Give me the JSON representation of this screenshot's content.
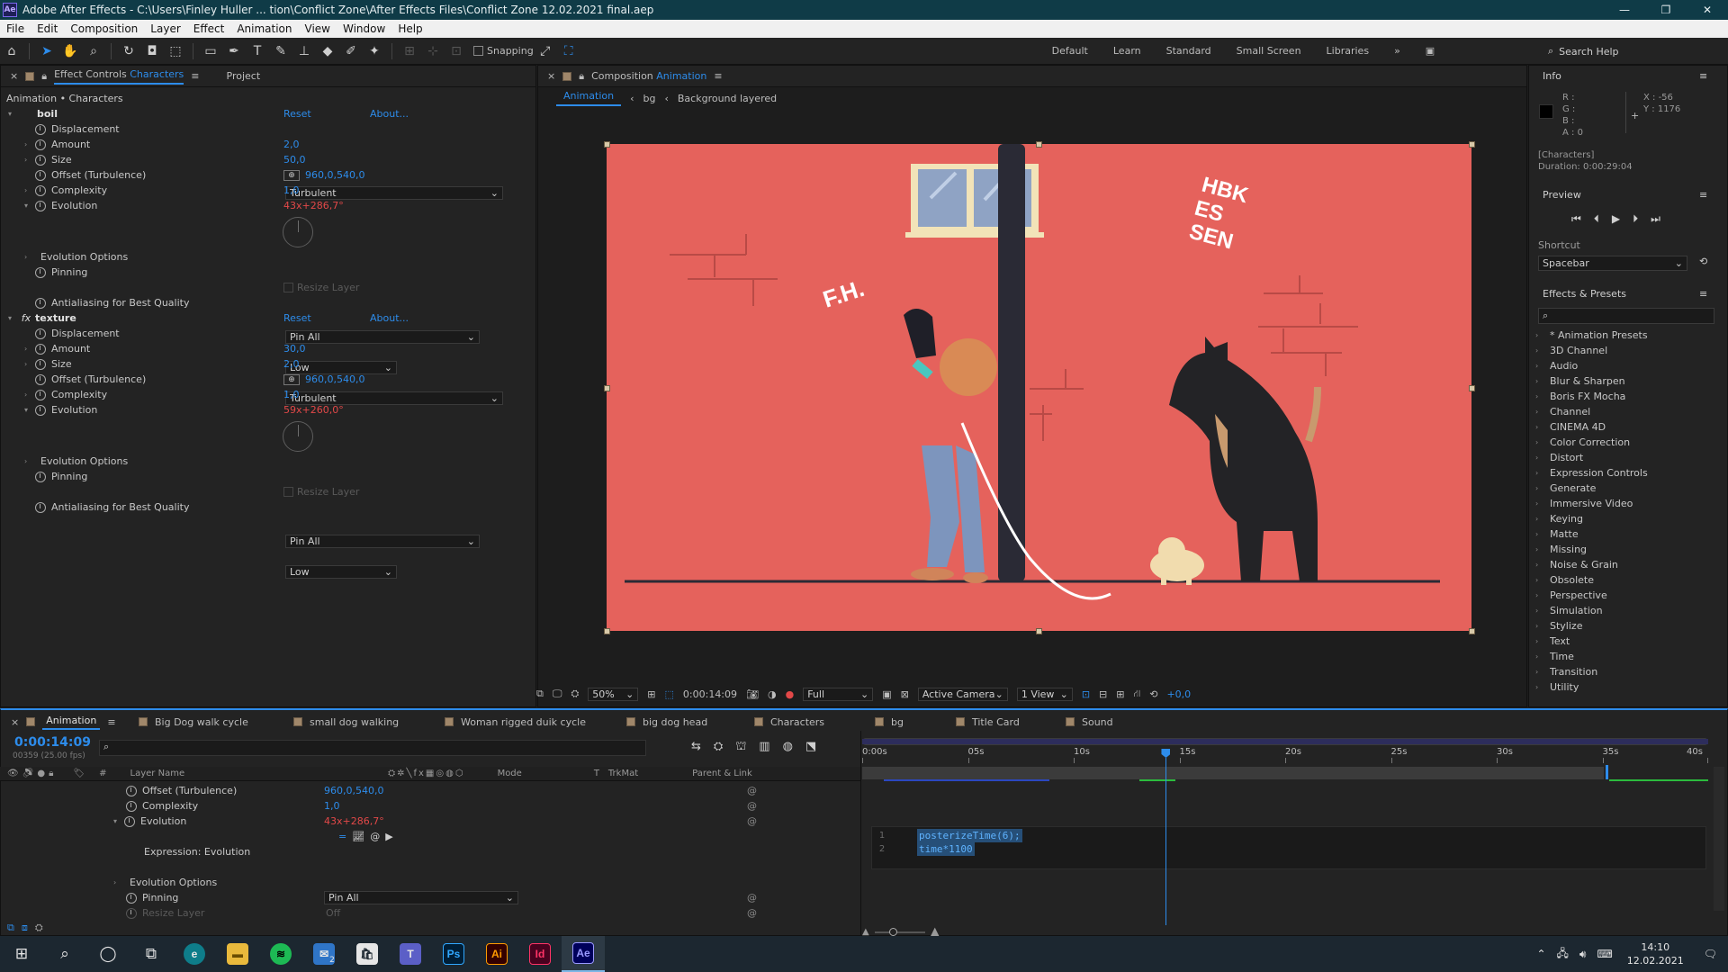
{
  "window": {
    "title": "Adobe After Effects - C:\\Users\\Finley Huller ... tion\\Conflict Zone\\After Effects Files\\Conflict Zone 12.02.2021 final.aep",
    "logo": "Ae"
  },
  "menu": [
    "File",
    "Edit",
    "Composition",
    "Layer",
    "Effect",
    "Animation",
    "View",
    "Window",
    "Help"
  ],
  "toolbar": {
    "snapping_label": "Snapping",
    "workspaces": [
      "Default",
      "Learn",
      "Standard",
      "Small Screen",
      "Libraries"
    ],
    "search_placeholder": "Search Help"
  },
  "effect_controls": {
    "tab_label": "Effect Controls",
    "tab_layer": "Characters",
    "project_tab": "Project",
    "header": "Animation • Characters",
    "reset": "Reset",
    "about": "About...",
    "effects": [
      {
        "name": "boil",
        "props": [
          {
            "label": "Displacement",
            "value": "Turbulent"
          },
          {
            "label": "Amount",
            "value": "2,0"
          },
          {
            "label": "Size",
            "value": "50,0"
          },
          {
            "label": "Offset (Turbulence)",
            "value": "960,0,540,0"
          },
          {
            "label": "Complexity",
            "value": "1,0"
          },
          {
            "label": "Evolution",
            "value": "43x+286,7°"
          },
          {
            "label": "Evolution Options",
            "value": ""
          },
          {
            "label": "Pinning",
            "value": "Pin All"
          },
          {
            "label": "Resize Layer",
            "value": ""
          },
          {
            "label": "Antialiasing for Best Quality",
            "value": "Low"
          }
        ]
      },
      {
        "name": "texture",
        "props": [
          {
            "label": "Displacement",
            "value": "Turbulent"
          },
          {
            "label": "Amount",
            "value": "30,0"
          },
          {
            "label": "Size",
            "value": "2,0"
          },
          {
            "label": "Offset (Turbulence)",
            "value": "960,0,540,0"
          },
          {
            "label": "Complexity",
            "value": "1,0"
          },
          {
            "label": "Evolution",
            "value": "59x+260,0°"
          },
          {
            "label": "Evolution Options",
            "value": ""
          },
          {
            "label": "Pinning",
            "value": "Pin All"
          },
          {
            "label": "Resize Layer",
            "value": ""
          },
          {
            "label": "Antialiasing for Best Quality",
            "value": "Low"
          }
        ]
      }
    ]
  },
  "composition": {
    "tab_label": "Composition",
    "tab_name": "Animation",
    "breadcrumbs": [
      "Animation",
      "bg",
      "Background layered"
    ],
    "canvas_texts": [
      "F.H.",
      "HBK",
      "ES",
      "SEN"
    ],
    "viewer_bar": {
      "zoom": "50%",
      "timecode": "0:00:14:09",
      "resolution": "Full",
      "camera": "Active Camera",
      "views": "1 View",
      "exposure": "+0,0"
    }
  },
  "info": {
    "title": "Info",
    "r": "R :",
    "g": "G :",
    "b": "B :",
    "a": "A : 0",
    "x": "X : -56",
    "y": "Y : 1176",
    "layer": "[Characters]",
    "duration": "Duration: 0:00:29:04"
  },
  "preview": {
    "title": "Preview",
    "shortcut_label": "Shortcut",
    "shortcut_value": "Spacebar"
  },
  "effects_presets": {
    "title": "Effects & Presets",
    "categories": [
      "* Animation Presets",
      "3D Channel",
      "Audio",
      "Blur & Sharpen",
      "Boris FX Mocha",
      "Channel",
      "CINEMA 4D",
      "Color Correction",
      "Distort",
      "Expression Controls",
      "Generate",
      "Immersive Video",
      "Keying",
      "Matte",
      "Missing",
      "Noise & Grain",
      "Obsolete",
      "Perspective",
      "Simulation",
      "Stylize",
      "Text",
      "Time",
      "Transition",
      "Utility"
    ]
  },
  "timeline": {
    "tabs": [
      "Animation",
      "Big Dog walk cycle",
      "small dog walking",
      "Woman rigged duik cycle",
      "big dog head",
      "Characters",
      "bg",
      "Title Card",
      "Sound"
    ],
    "timecode": "0:00:14:09",
    "frame_info": "00359 (25.00 fps)",
    "columns": {
      "layer_name": "Layer Name",
      "mode": "Mode",
      "t": "T",
      "trkmat": "TrkMat",
      "parent": "Parent & Link"
    },
    "rows": [
      {
        "label": "Offset (Turbulence)",
        "value": "960,0,540,0"
      },
      {
        "label": "Complexity",
        "value": "1,0"
      },
      {
        "label": "Evolution",
        "value": "43x+286,7°"
      },
      {
        "label": "Expression: Evolution",
        "value": ""
      },
      {
        "label": "Evolution Options",
        "value": ""
      },
      {
        "label": "Pinning",
        "value": "Pin All"
      },
      {
        "label": "Resize Layer",
        "value": "Off"
      }
    ],
    "ruler": [
      "0:00s",
      "05s",
      "10s",
      "15s",
      "20s",
      "25s",
      "30s",
      "35s",
      "40s"
    ],
    "expression": [
      "posterizeTime(6);",
      "time*1100"
    ],
    "playhead_seconds": 14.36
  },
  "taskbar": {
    "time": "14:10",
    "date": "12.02.2021",
    "apps": [
      "Ps",
      "Ai",
      "Id",
      "Ae"
    ],
    "mail_badge": "2"
  }
}
